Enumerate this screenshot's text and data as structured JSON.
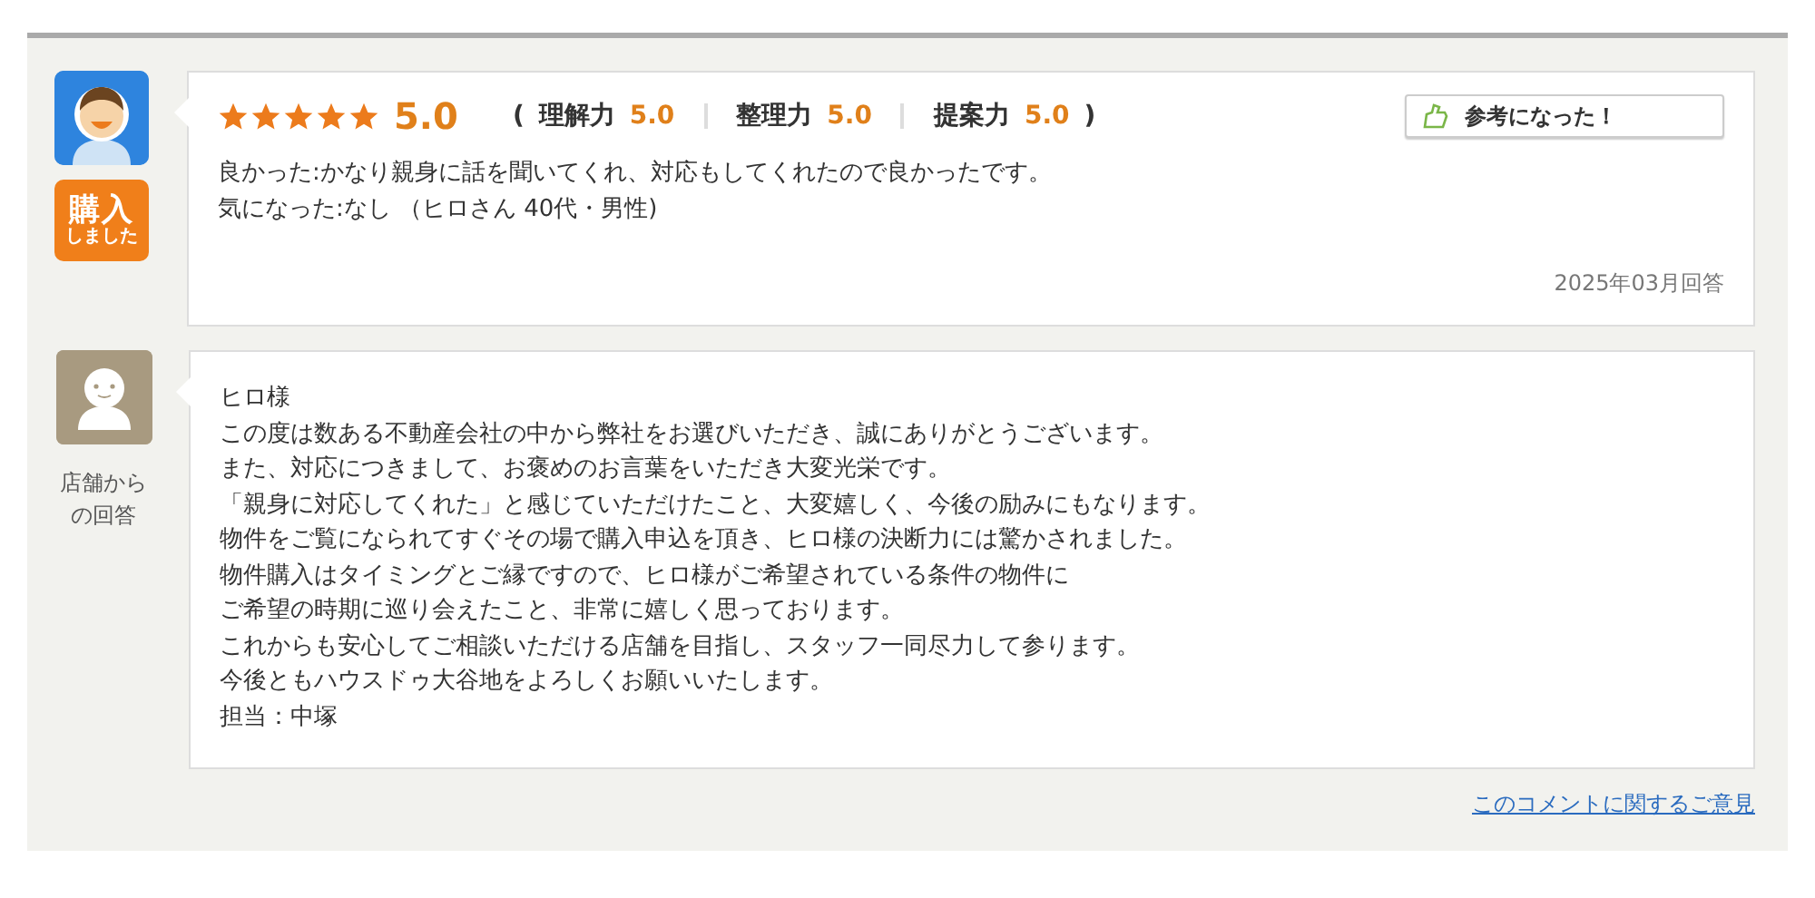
{
  "review": {
    "badge": {
      "title": "購入",
      "subtitle": "しました"
    },
    "stars": 5,
    "score": "5.0",
    "sub_ratings": [
      {
        "label": "理解力",
        "score": "5.0"
      },
      {
        "label": "整理力",
        "score": "5.0"
      },
      {
        "label": "提案力",
        "score": "5.0"
      }
    ],
    "open_paren": "(",
    "close_paren": ")",
    "helpful_button": "参考になった！",
    "lines": [
      "良かった:かなり親身に話を聞いてくれ、対応もしてくれたので良かったです。",
      "気になった:なし （ヒロさん 40代・男性)"
    ],
    "date": "2025年03月回答"
  },
  "reply": {
    "label_lines": [
      "店舗から",
      "の回答"
    ],
    "lines": [
      "ヒロ様",
      "この度は数ある不動産会社の中から弊社をお選びいただき、誠にありがとうございます。",
      "また、対応につきまして、お褒めのお言葉をいただき大変光栄です。",
      "「親身に対応してくれた」と感じていただけたこと、大変嬉しく、今後の励みにもなります。",
      "物件をご覧になられてすぐその場で購入申込を頂き、ヒロ様の決断力には驚かされました。",
      "物件購入はタイミングとご縁ですので、ヒロ様がご希望されている条件の物件に",
      "ご希望の時期に巡り会えたこと、非常に嬉しく思っております。",
      "これからも安心してご相談いただける店舗を目指し、スタッフ一同尽力して参ります。",
      "今後ともハウスドゥ大谷地をよろしくお願いいたします。",
      "担当：中塚"
    ]
  },
  "feedback_link": "このコメントに関するご意見"
}
